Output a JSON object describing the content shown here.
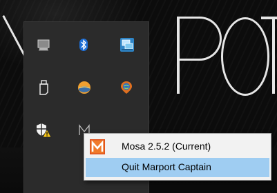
{
  "background": {
    "wall_text": "PORT"
  },
  "tray": {
    "icons": [
      {
        "name": "network-monitor-icon"
      },
      {
        "name": "bluetooth-icon",
        "color": "#1e6fd6"
      },
      {
        "name": "network-display-icon",
        "color": "#3aa0d8"
      },
      {
        "name": "usb-drive-icon"
      },
      {
        "name": "weather-sun-icon",
        "color": "#f0a030"
      },
      {
        "name": "location-globe-icon",
        "color": "#e07020"
      },
      {
        "name": "windows-security-warning-icon",
        "color": "#f5c518"
      },
      {
        "name": "marport-m-icon"
      }
    ]
  },
  "context_menu": {
    "items": [
      {
        "label": "Mosa 2.5.2 (Current)",
        "icon": "marport-m-icon",
        "icon_color": "#e0501c"
      },
      {
        "label": "Quit Marport Captain",
        "highlighted": true
      }
    ],
    "highlight_color": "#9fcdf2"
  }
}
